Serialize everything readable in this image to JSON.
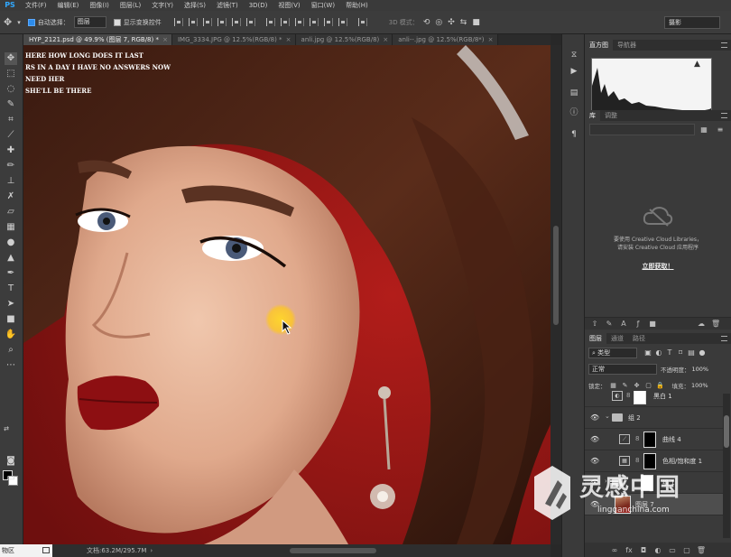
{
  "app": {
    "logo": "PS"
  },
  "menu": [
    "文件(F)",
    "编辑(E)",
    "图像(I)",
    "图层(L)",
    "文字(Y)",
    "选择(S)",
    "滤镜(T)",
    "3D(D)",
    "视图(V)",
    "窗口(W)",
    "帮助(H)"
  ],
  "options": {
    "auto_select_label": "自动选择：",
    "auto_select_value": "图层",
    "show_transform_label": "显示变换控件",
    "mode_3d_label": "3D 模式：",
    "workspace": "摄影"
  },
  "tabs": [
    {
      "label": "HYP_2121.psd @ 49.9% (图层 7, RGB/8) *",
      "active": true
    },
    {
      "label": "IMG_3334.JPG @ 12.5%(RGB/8) *",
      "active": false
    },
    {
      "label": "anli.jpg @ 12.5%(RGB/8)",
      "active": false
    },
    {
      "label": "anli--.jpg @ 12.5%(RGB/8*)",
      "active": false
    }
  ],
  "canvas": {
    "lines": [
      "HERE HOW LONG DOES IT LAST",
      "RS IN A DAY I HAVE NO ANSWERS NOW",
      "NEED HER",
      "SHE'LL BE THERE"
    ]
  },
  "status": {
    "zoom": "物区",
    "doc": "文档:63.2M/295.7M"
  },
  "panels": {
    "histogram_tabs": [
      "直方图",
      "导航器"
    ],
    "library_tabs": [
      "库",
      "调整"
    ],
    "cc_message_1": "要使用 Creative Cloud Libraries，",
    "cc_message_2": "请安装 Creative Cloud 应用程序",
    "cc_link": "立即获取！",
    "layers_tabs": [
      "图层",
      "通道",
      "路径"
    ],
    "filter_kind": "类型",
    "blend_mode": "正常",
    "opacity_label": "不透明度：",
    "opacity_value": "100%",
    "lock_label": "锁定：",
    "fill_label": "填充：",
    "fill_value": "100%"
  },
  "layers": [
    {
      "name": "黑白 1",
      "type": "adjustment"
    },
    {
      "name": "组 2",
      "type": "group"
    },
    {
      "name": "曲线 4",
      "type": "adjustment"
    },
    {
      "name": "色相/饱和度 1",
      "type": "adjustment"
    },
    {
      "name": "组 1",
      "type": "group"
    },
    {
      "name": "图层 7",
      "type": "pixel",
      "selected": true
    }
  ],
  "watermark": {
    "cn": "灵感中国",
    "url": "lingganchina.com"
  },
  "colors": {
    "ps_blue": "#31a8ff",
    "canvas_bg": "#9c1a18",
    "highlight": "#ffd728"
  }
}
